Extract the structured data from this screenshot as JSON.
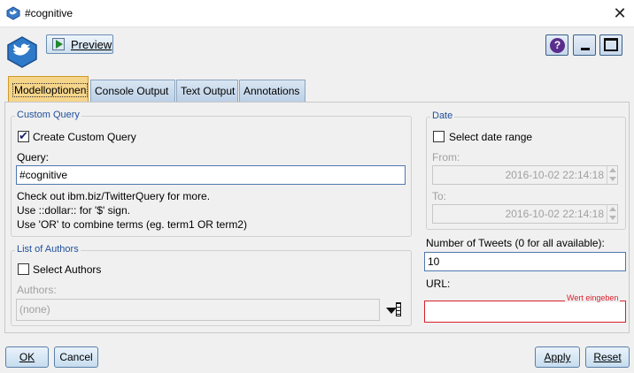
{
  "window": {
    "title": "#cognitive"
  },
  "toolbar": {
    "preview_label": "Preview",
    "help_glyph": "?"
  },
  "tabs": [
    {
      "label": "Modelloptionen",
      "active": true
    },
    {
      "label": "Console Output",
      "active": false
    },
    {
      "label": "Text Output",
      "active": false
    },
    {
      "label": "Annotations",
      "active": false
    }
  ],
  "custom_query": {
    "group_title": "Custom Query",
    "create_custom_query_label": "Create Custom Query",
    "create_custom_query_checked": true,
    "query_label": "Query:",
    "query_value": "#cognitive",
    "help_lines": [
      "Check out ibm.biz/TwitterQuery for more.",
      "Use ::dollar:: for '$' sign.",
      "Use 'OR' to combine terms (eg. term1 OR term2)"
    ]
  },
  "authors": {
    "group_title": "List of Authors",
    "select_authors_label": "Select Authors",
    "select_authors_checked": false,
    "authors_label": "Authors:",
    "authors_value": "(none)"
  },
  "date": {
    "group_title": "Date",
    "select_date_range_label": "Select date range",
    "select_date_range_checked": false,
    "from_label": "From:",
    "from_value": "2016-10-02 22:14:18",
    "to_label": "To:",
    "to_value": "2016-10-02 22:14:18"
  },
  "tweets": {
    "label": "Number of Tweets (0 for all available):",
    "value": "10"
  },
  "url": {
    "label": "URL:",
    "value": "",
    "error_hint": "Wert eingeben"
  },
  "buttons": {
    "ok": "OK",
    "cancel": "Cancel",
    "apply": "Apply",
    "reset": "Reset"
  },
  "colors": {
    "accent_blue": "#1f4f9c",
    "active_tab": "#f5d58a",
    "error_red": "#d8202c"
  }
}
